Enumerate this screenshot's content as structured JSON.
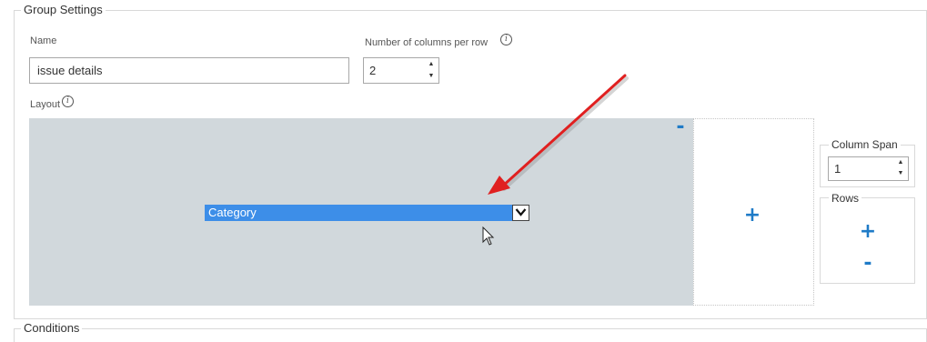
{
  "group_settings": {
    "legend": "Group Settings",
    "name_label": "Name",
    "name_value": "issue details",
    "columns_label": "Number of columns per row",
    "columns_value": "2",
    "layout_label": "Layout"
  },
  "layout": {
    "active_cell_minus": "-",
    "field_selected": "Category",
    "empty_cell_plus": "+"
  },
  "column_span": {
    "legend": "Column Span",
    "value": "1"
  },
  "rows": {
    "legend": "Rows",
    "add": "+",
    "remove": "-"
  },
  "conditions": {
    "legend": "Conditions"
  },
  "icons": {
    "info": "info-icon",
    "spin_up": "up-arrow-icon",
    "spin_down": "down-arrow-icon",
    "dropdown": "chevron-down-icon",
    "annotation": "red-arrow-annotation",
    "cursor": "mouse-cursor-icon"
  },
  "colors": {
    "selection_blue": "#3d8ee8",
    "action_blue": "#1f7bc7",
    "active_cell_gray": "#d1d8dc",
    "annotation_red": "#e02020"
  }
}
